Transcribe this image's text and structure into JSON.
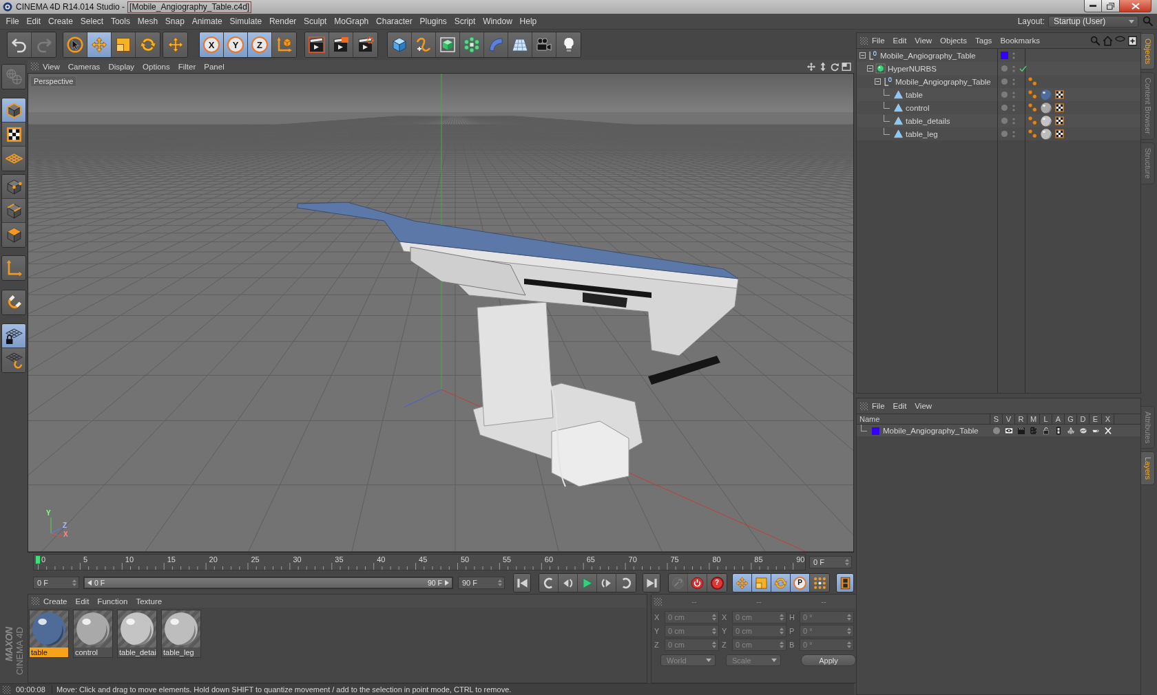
{
  "window": {
    "title": "CINEMA 4D R14.014 Studio -",
    "document": "[Mobile_Angiography_Table.c4d]"
  },
  "menu": [
    "File",
    "Edit",
    "Create",
    "Select",
    "Tools",
    "Mesh",
    "Snap",
    "Animate",
    "Simulate",
    "Render",
    "Sculpt",
    "MoGraph",
    "Character",
    "Plugins",
    "Script",
    "Window",
    "Help"
  ],
  "layout": {
    "label": "Layout:",
    "value": "Startup (User)"
  },
  "toolbar": [
    {
      "tools": [
        {
          "kind": "undo",
          "selected": false,
          "disabled": false
        },
        {
          "kind": "redo",
          "selected": false,
          "disabled": true
        }
      ]
    },
    {
      "tools": [
        {
          "kind": "live_select",
          "selected": false,
          "disabled": false
        },
        {
          "kind": "move",
          "selected": true,
          "disabled": false
        },
        {
          "kind": "scale",
          "selected": false,
          "disabled": false
        },
        {
          "kind": "rotate",
          "selected": false,
          "disabled": false
        }
      ]
    },
    {
      "tools": [
        {
          "kind": "recent",
          "selected": false,
          "disabled": false
        }
      ]
    },
    {
      "tools": [
        {
          "kind": "axis",
          "label": "X",
          "selected": true,
          "disabled": false
        },
        {
          "kind": "axis",
          "label": "Y",
          "selected": true,
          "disabled": false
        },
        {
          "kind": "axis",
          "label": "Z",
          "selected": true,
          "disabled": false
        },
        {
          "kind": "coord_system",
          "selected": false,
          "disabled": false
        }
      ]
    },
    {
      "tools": [
        {
          "kind": "render_view",
          "selected": false,
          "disabled": false
        },
        {
          "kind": "render_picture",
          "selected": false,
          "disabled": false
        },
        {
          "kind": "render_settings",
          "selected": false,
          "disabled": false
        }
      ]
    },
    {
      "tools": [
        {
          "kind": "cube",
          "selected": false,
          "disabled": false
        },
        {
          "kind": "spline_pen",
          "selected": false,
          "disabled": false
        },
        {
          "kind": "hypernurbs",
          "selected": false,
          "disabled": false
        },
        {
          "kind": "cloner",
          "selected": false,
          "disabled": false
        },
        {
          "kind": "bend",
          "selected": false,
          "disabled": false
        },
        {
          "kind": "floor",
          "selected": false,
          "disabled": false
        },
        {
          "kind": "camera",
          "selected": false,
          "disabled": false
        },
        {
          "kind": "light",
          "selected": false,
          "disabled": false
        }
      ]
    }
  ],
  "mode_bar": [
    {
      "tools": [
        {
          "kind": "make_editable",
          "selected": false,
          "disabled": true
        }
      ]
    },
    {
      "tools": [
        {
          "kind": "model",
          "selected": true,
          "disabled": false
        },
        {
          "kind": "texture",
          "selected": false,
          "disabled": false
        },
        {
          "kind": "workplane",
          "selected": false,
          "disabled": false
        }
      ]
    },
    {
      "tools": [
        {
          "kind": "points",
          "selected": false,
          "disabled": false
        },
        {
          "kind": "edges",
          "selected": false,
          "disabled": false
        },
        {
          "kind": "polygons",
          "selected": false,
          "disabled": false
        }
      ]
    },
    {
      "tools": [
        {
          "kind": "object_axis",
          "selected": false,
          "disabled": false
        }
      ]
    },
    {
      "tools": [
        {
          "kind": "snap",
          "selected": false,
          "disabled": false
        }
      ]
    },
    {
      "tools": [
        {
          "kind": "locked_workplane",
          "selected": true,
          "disabled": false
        },
        {
          "kind": "workplane_snap",
          "selected": false,
          "disabled": false
        }
      ]
    }
  ],
  "viewport": {
    "menu": [
      "View",
      "Cameras",
      "Display",
      "Options",
      "Filter",
      "Panel"
    ],
    "camera": "Perspective",
    "axis_labels": [
      "Y",
      "Z",
      "X"
    ]
  },
  "objects": {
    "menu": [
      "File",
      "Edit",
      "View",
      "Objects",
      "Tags",
      "Bookmarks"
    ],
    "tree": [
      {
        "name": "Mobile_Angiography_Table",
        "kind": "null",
        "expanded": true,
        "color": "#3300ff",
        "children": [
          {
            "name": "HyperNURBS",
            "kind": "hypernurbs",
            "expanded": true,
            "enabled": true,
            "children": [
              {
                "name": "Mobile_Angiography_Table",
                "kind": "null",
                "expanded": true,
                "tags": [
                  {
                    "kind": "phong"
                  }
                ],
                "children": [
                  {
                    "name": "table",
                    "kind": "polygon",
                    "tags": [
                      {
                        "kind": "phong"
                      },
                      {
                        "kind": "material",
                        "color": "#4f6c98"
                      },
                      {
                        "kind": "texture"
                      }
                    ]
                  },
                  {
                    "name": "control",
                    "kind": "polygon",
                    "tags": [
                      {
                        "kind": "phong"
                      },
                      {
                        "kind": "material",
                        "color": "#a9a9a9"
                      },
                      {
                        "kind": "texture"
                      }
                    ]
                  },
                  {
                    "name": "table_details",
                    "kind": "polygon",
                    "tags": [
                      {
                        "kind": "phong"
                      },
                      {
                        "kind": "material",
                        "color": "#c4c4c4"
                      },
                      {
                        "kind": "texture"
                      }
                    ]
                  },
                  {
                    "name": "table_leg",
                    "kind": "polygon",
                    "tags": [
                      {
                        "kind": "phong"
                      },
                      {
                        "kind": "material",
                        "color": "#bdbdbd"
                      },
                      {
                        "kind": "texture"
                      }
                    ]
                  }
                ]
              }
            ]
          }
        ]
      }
    ]
  },
  "layers": {
    "menu": [
      "File",
      "Edit",
      "View"
    ],
    "columns": [
      "Name",
      "S",
      "V",
      "R",
      "M",
      "L",
      "A",
      "G",
      "D",
      "E",
      "X"
    ],
    "rows": [
      {
        "name": "Mobile_Angiography_Table",
        "color": "#3300ff"
      }
    ]
  },
  "side_tabs": {
    "top": [
      {
        "label": "Objects",
        "selected": true
      },
      {
        "label": "Content Browser",
        "selected": false
      },
      {
        "label": "Structure",
        "selected": false
      }
    ],
    "bottom": [
      {
        "label": "Attributes",
        "selected": false
      },
      {
        "label": "Layers",
        "selected": true
      }
    ]
  },
  "timeline": {
    "ticks": [
      "0",
      "5",
      "10",
      "15",
      "20",
      "25",
      "30",
      "35",
      "40",
      "45",
      "50",
      "55",
      "60",
      "65",
      "70",
      "75",
      "80",
      "85",
      "90"
    ],
    "level": 0,
    "current": "0 F"
  },
  "transport": {
    "start": "0 F",
    "range": {
      "start": "0 F",
      "end": "90 F",
      "level": 1
    },
    "end": "90 F",
    "groups": [
      {
        "tools": [
          {
            "kind": "go_start",
            "selected": false,
            "disabled": false
          }
        ]
      },
      {
        "tools": [
          {
            "kind": "prev_key",
            "selected": false,
            "disabled": false
          },
          {
            "kind": "step_back",
            "selected": false,
            "disabled": false
          },
          {
            "kind": "play",
            "selected": false,
            "disabled": false
          },
          {
            "kind": "step_forward",
            "selected": false,
            "disabled": false
          },
          {
            "kind": "next_key",
            "selected": false,
            "disabled": false
          }
        ]
      },
      {
        "tools": [
          {
            "kind": "go_end",
            "selected": false,
            "disabled": false
          }
        ]
      },
      {
        "tools": [
          {
            "kind": "autokey",
            "selected": false,
            "disabled": true
          },
          {
            "kind": "record",
            "selected": false,
            "disabled": false
          },
          {
            "kind": "key_help",
            "label": "?",
            "selected": false,
            "disabled": false
          }
        ]
      },
      {
        "tools": [
          {
            "kind": "move_key",
            "selected": true,
            "disabled": false
          },
          {
            "kind": "scale_key",
            "selected": true,
            "disabled": false
          },
          {
            "kind": "rotate_key",
            "selected": true,
            "disabled": false
          },
          {
            "kind": "param_key",
            "label": "P",
            "selected": true,
            "disabled": false
          },
          {
            "kind": "pla",
            "selected": false,
            "disabled": false
          }
        ]
      },
      {
        "tools": [
          {
            "kind": "timeline",
            "selected": true,
            "disabled": false
          }
        ]
      }
    ]
  },
  "materials": {
    "menu": [
      "Create",
      "Edit",
      "Function",
      "Texture"
    ],
    "items": [
      {
        "name": "table",
        "selected": true,
        "color": "#4f6c98"
      },
      {
        "name": "control",
        "selected": false,
        "color": "#a9a9a9"
      },
      {
        "name": "table_detai",
        "selected": false,
        "color": "#c4c4c4"
      },
      {
        "name": "table_leg",
        "selected": false,
        "color": "#bdbdbd"
      }
    ]
  },
  "coordinates": {
    "headers": [
      "--",
      "--",
      "--"
    ],
    "rows": [
      {
        "position_axis": "X",
        "position": "0 cm",
        "size_axis": "X",
        "size": "0 cm",
        "rotation_axis": "H",
        "rotation": "0 °"
      },
      {
        "position_axis": "Y",
        "position": "0 cm",
        "size_axis": "Y",
        "size": "0 cm",
        "rotation_axis": "P",
        "rotation": "0 °"
      },
      {
        "position_axis": "Z",
        "position": "0 cm",
        "size_axis": "Z",
        "size": "0 cm",
        "rotation_axis": "B",
        "rotation": "0 °"
      }
    ],
    "space": "World",
    "mode": "Scale",
    "apply": "Apply"
  },
  "logo": {
    "brand": "MAXON",
    "product": "CINEMA 4D"
  },
  "status_bar": {
    "time": "00:00:08",
    "message": "Move: Click and drag to move elements. Hold down SHIFT to quantize movement / add to the selection in point mode, CTRL to remove."
  }
}
